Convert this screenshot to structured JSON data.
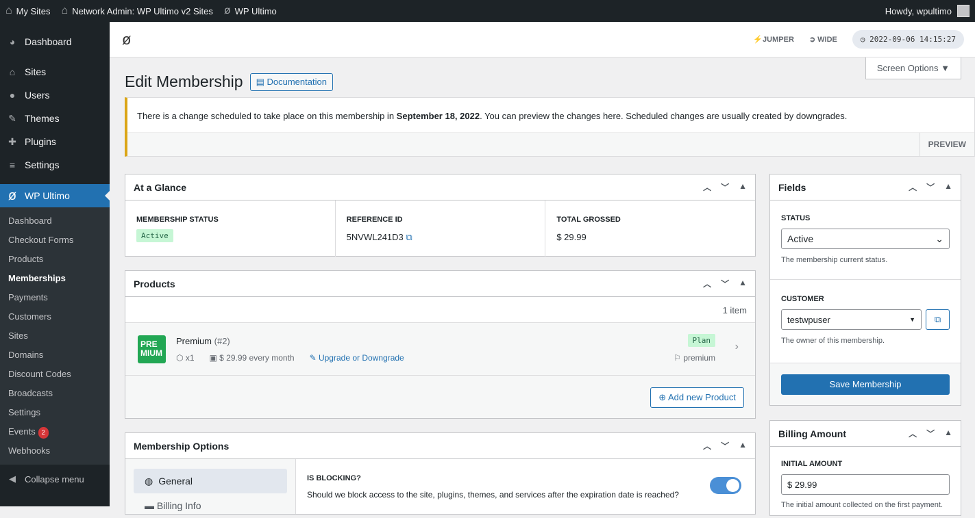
{
  "adminbar": {
    "my_sites": "My Sites",
    "network_admin": "Network Admin: WP Ultimo v2 Sites",
    "wp_ultimo": "WP Ultimo",
    "howdy": "Howdy, wpultimo"
  },
  "sidebar": {
    "top": [
      {
        "label": "Dashboard",
        "icon": "◕"
      },
      {
        "label": "Sites",
        "icon": "⌂"
      },
      {
        "label": "Users",
        "icon": "●"
      },
      {
        "label": "Themes",
        "icon": "✎"
      },
      {
        "label": "Plugins",
        "icon": "✚"
      },
      {
        "label": "Settings",
        "icon": "≡"
      }
    ],
    "active": "WP Ultimo",
    "sub": [
      "Dashboard",
      "Checkout Forms",
      "Products",
      "Memberships",
      "Payments",
      "Customers",
      "Sites",
      "Domains",
      "Discount Codes",
      "Broadcasts",
      "Settings",
      "Events",
      "Webhooks"
    ],
    "events_badge": "2",
    "collapse": "Collapse menu"
  },
  "topbar": {
    "jumper": "JUMPER",
    "wide": "WIDE",
    "clock": "2022-09-06 14:15:27"
  },
  "screen_options": "Screen Options",
  "page": {
    "title": "Edit Membership",
    "doc": "Documentation"
  },
  "notice": {
    "pre": "There is a change scheduled to take place on this membership in ",
    "date": "September 18, 2022",
    "post": ". You can preview the changes here. Scheduled changes are usually created by downgrades.",
    "preview": "PREVIEW"
  },
  "glance": {
    "title": "At a Glance",
    "status_label": "Membership Status",
    "status": "Active",
    "ref_label": "Reference ID",
    "ref": "5NVWL241D3",
    "total_label": "Total Grossed",
    "total": "$ 29.99"
  },
  "products": {
    "title": "Products",
    "count": "1 item",
    "thumb": "PRE MIUM",
    "name": "Premium",
    "id": "(#2)",
    "qty": "x1",
    "price": "$ 29.99 every month",
    "upgrade": "Upgrade or Downgrade",
    "type": "Plan",
    "slug": "premium",
    "add": "Add new Product"
  },
  "options": {
    "title": "Membership Options",
    "tabs": [
      "General",
      "Billing Info"
    ],
    "blocking_label": "Is Blocking?",
    "blocking_desc": "Should we block access to the site, plugins, themes, and services after the expiration date is reached?",
    "blocking": true
  },
  "fields": {
    "title": "Fields",
    "status_label": "Status",
    "status": "Active",
    "status_help": "The membership current status.",
    "customer_label": "Customer",
    "customer": "testwpuser",
    "customer_help": "The owner of this membership.",
    "save": "Save Membership"
  },
  "billing": {
    "title": "Billing Amount",
    "initial_label": "Initial Amount",
    "initial": "$ 29.99",
    "initial_help": "The initial amount collected on the first payment."
  }
}
